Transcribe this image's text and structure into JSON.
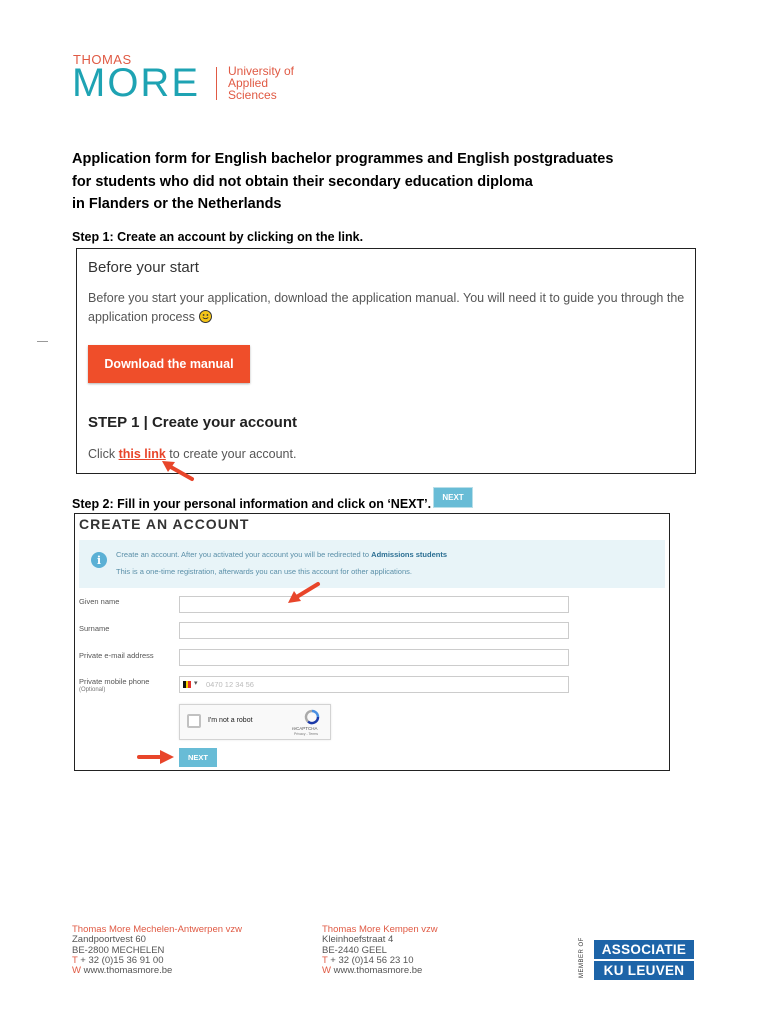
{
  "logo": {
    "top": "THOMAS",
    "main": "MORE",
    "subtitle_lines": [
      "University of",
      "Applied",
      "Sciences"
    ]
  },
  "title_lines": [
    "Application form for English bachelor programmes and English postgraduates",
    "for students who did not obtain their secondary education diploma",
    "in Flanders or the Netherlands"
  ],
  "step1_label": "Step 1: Create an account by clicking on the link.",
  "before_box": {
    "heading": "Before your start",
    "text": "Before you start your application, download the application manual. You will need it to guide you through the application process",
    "download_button": "Download the manual",
    "step_heading": "STEP 1 | Create your account",
    "click_prefix": "Click",
    "link_text": "this link",
    "click_suffix": "to create your account."
  },
  "step2_label": "Step 2: Fill in your personal information and click on ‘NEXT’.",
  "next_mini_label": "NEXT",
  "account_form": {
    "title": "CREATE AN ACCOUNT",
    "info_line1_prefix": "Create an account. After you activated your account you will be redirected to",
    "info_line1_bold": "Admissions students",
    "info_line2": "This is a one-time registration, afterwards you can use this account for other applications.",
    "fields": {
      "given_name": "Given name",
      "surname": "Surname",
      "email": "Private e-mail address",
      "mobile": "Private mobile phone",
      "optional": "(Optional)"
    },
    "phone_placeholder": "0470 12 34 56",
    "captcha_label": "I'm not a robot",
    "captcha_brand": "reCAPTCHA",
    "captcha_terms": "Privacy - Terms",
    "next_button": "NEXT"
  },
  "footer": {
    "left": {
      "name": "Thomas More Mechelen-Antwerpen vzw",
      "street": "Zandpoortvest 60",
      "city": "BE-2800 MECHELEN",
      "phone": "+ 32 (0)15 36 91 00",
      "web": "www.thomasmore.be"
    },
    "right": {
      "name": "Thomas More Kempen vzw",
      "street": "Kleinhoefstraat 4",
      "city": "BE-2440 GEEL",
      "phone": "+ 32 (0)14 56 23 10",
      "web": "www.thomasmore.be"
    },
    "phone_prefix": "T",
    "web_prefix": "W",
    "member_of": "MEMBER OF",
    "associatie": "ASSOCIATIE",
    "ku_leuven": "KU LEUVEN"
  },
  "colors": {
    "brand_orange": "#e05a44",
    "brand_teal": "#1ea3b3",
    "download_button": "#ef4e2a",
    "next_button": "#68bcd6",
    "associatie_blue": "#1d64a8"
  }
}
